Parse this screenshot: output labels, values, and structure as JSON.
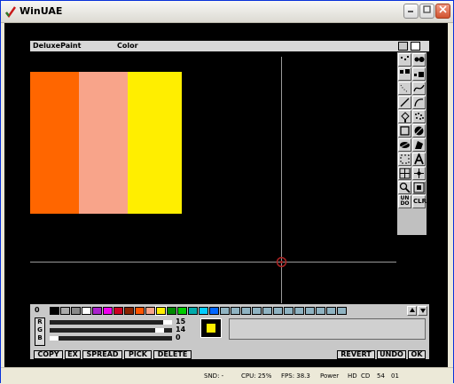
{
  "window": {
    "title": "WinUAE"
  },
  "amiga_menu": {
    "app": "DeluxePaint",
    "menu2": "Color"
  },
  "toolbox": {
    "undo": "UN DO",
    "clr": "CLR"
  },
  "canvas": {
    "stripes": [
      "#ff6600",
      "#f8a48a",
      "#ffee00"
    ]
  },
  "palette": {
    "index_label": "0",
    "swatches": [
      "#000000",
      "#aaaaaa",
      "#888888",
      "#ffffff",
      "#aa22cc",
      "#ee00ee",
      "#cc0022",
      "#882200",
      "#ff5500",
      "#f8a48a",
      "#ffee00",
      "#008800",
      "#00cc00",
      "#00aaaa",
      "#00ccff",
      "#0066ff"
    ],
    "empty_count": 12
  },
  "color_editor": {
    "channel_labels": [
      "R",
      "G",
      "B"
    ],
    "values": {
      "r": "15",
      "g": "14",
      "b": "0"
    },
    "levels": {
      "r": 15,
      "g": 14,
      "b": 0
    },
    "current_color": "#ffee00"
  },
  "buttons": {
    "copy": "COPY",
    "ex": "EX",
    "spread": "SPREAD",
    "pick": "PICK",
    "delete": "DELETE",
    "revert": "REVERT",
    "undo": "UNDO",
    "ok": "OK"
  },
  "status": {
    "snd": "SND: -",
    "cpu": "CPU: 25%",
    "fps": "FPS: 38.3",
    "power": "Power",
    "hd": "HD",
    "cd": "CD",
    "drive": "54",
    "num": "01"
  }
}
